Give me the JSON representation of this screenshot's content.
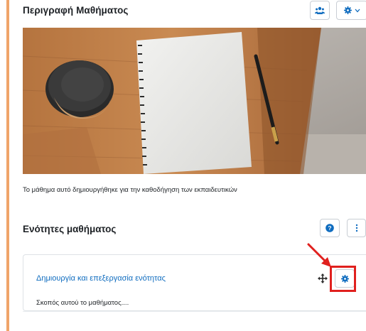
{
  "header": {
    "title": "Περιγραφή Μαθήματος",
    "users_icon": "users-icon",
    "gear_icon": "gear-icon",
    "chevron_icon": "chevron-down-icon"
  },
  "hero_image": {
    "subject": "notebook-and-coffee-cup-on-wooden-table"
  },
  "description": "Το μάθημα αυτό δημιουργήθηκε για την καθοδήγηση των εκπαιδευτικών",
  "sections": {
    "title": "Ενότητες μαθήματος",
    "help_icon": "help-icon",
    "more_icon": "more-vertical-icon",
    "items": [
      {
        "title": "Δημιουργία και επεξεργασία ενότητας",
        "summary": "Σκοπός αυτού το μαθήματος....",
        "move_icon": "move-icon",
        "settings_icon": "gear-icon"
      }
    ]
  },
  "colors": {
    "accent": "#f0a46a",
    "link": "#0f6cbf",
    "icon": "#0f6cbf",
    "annotation": "#e0201e"
  }
}
